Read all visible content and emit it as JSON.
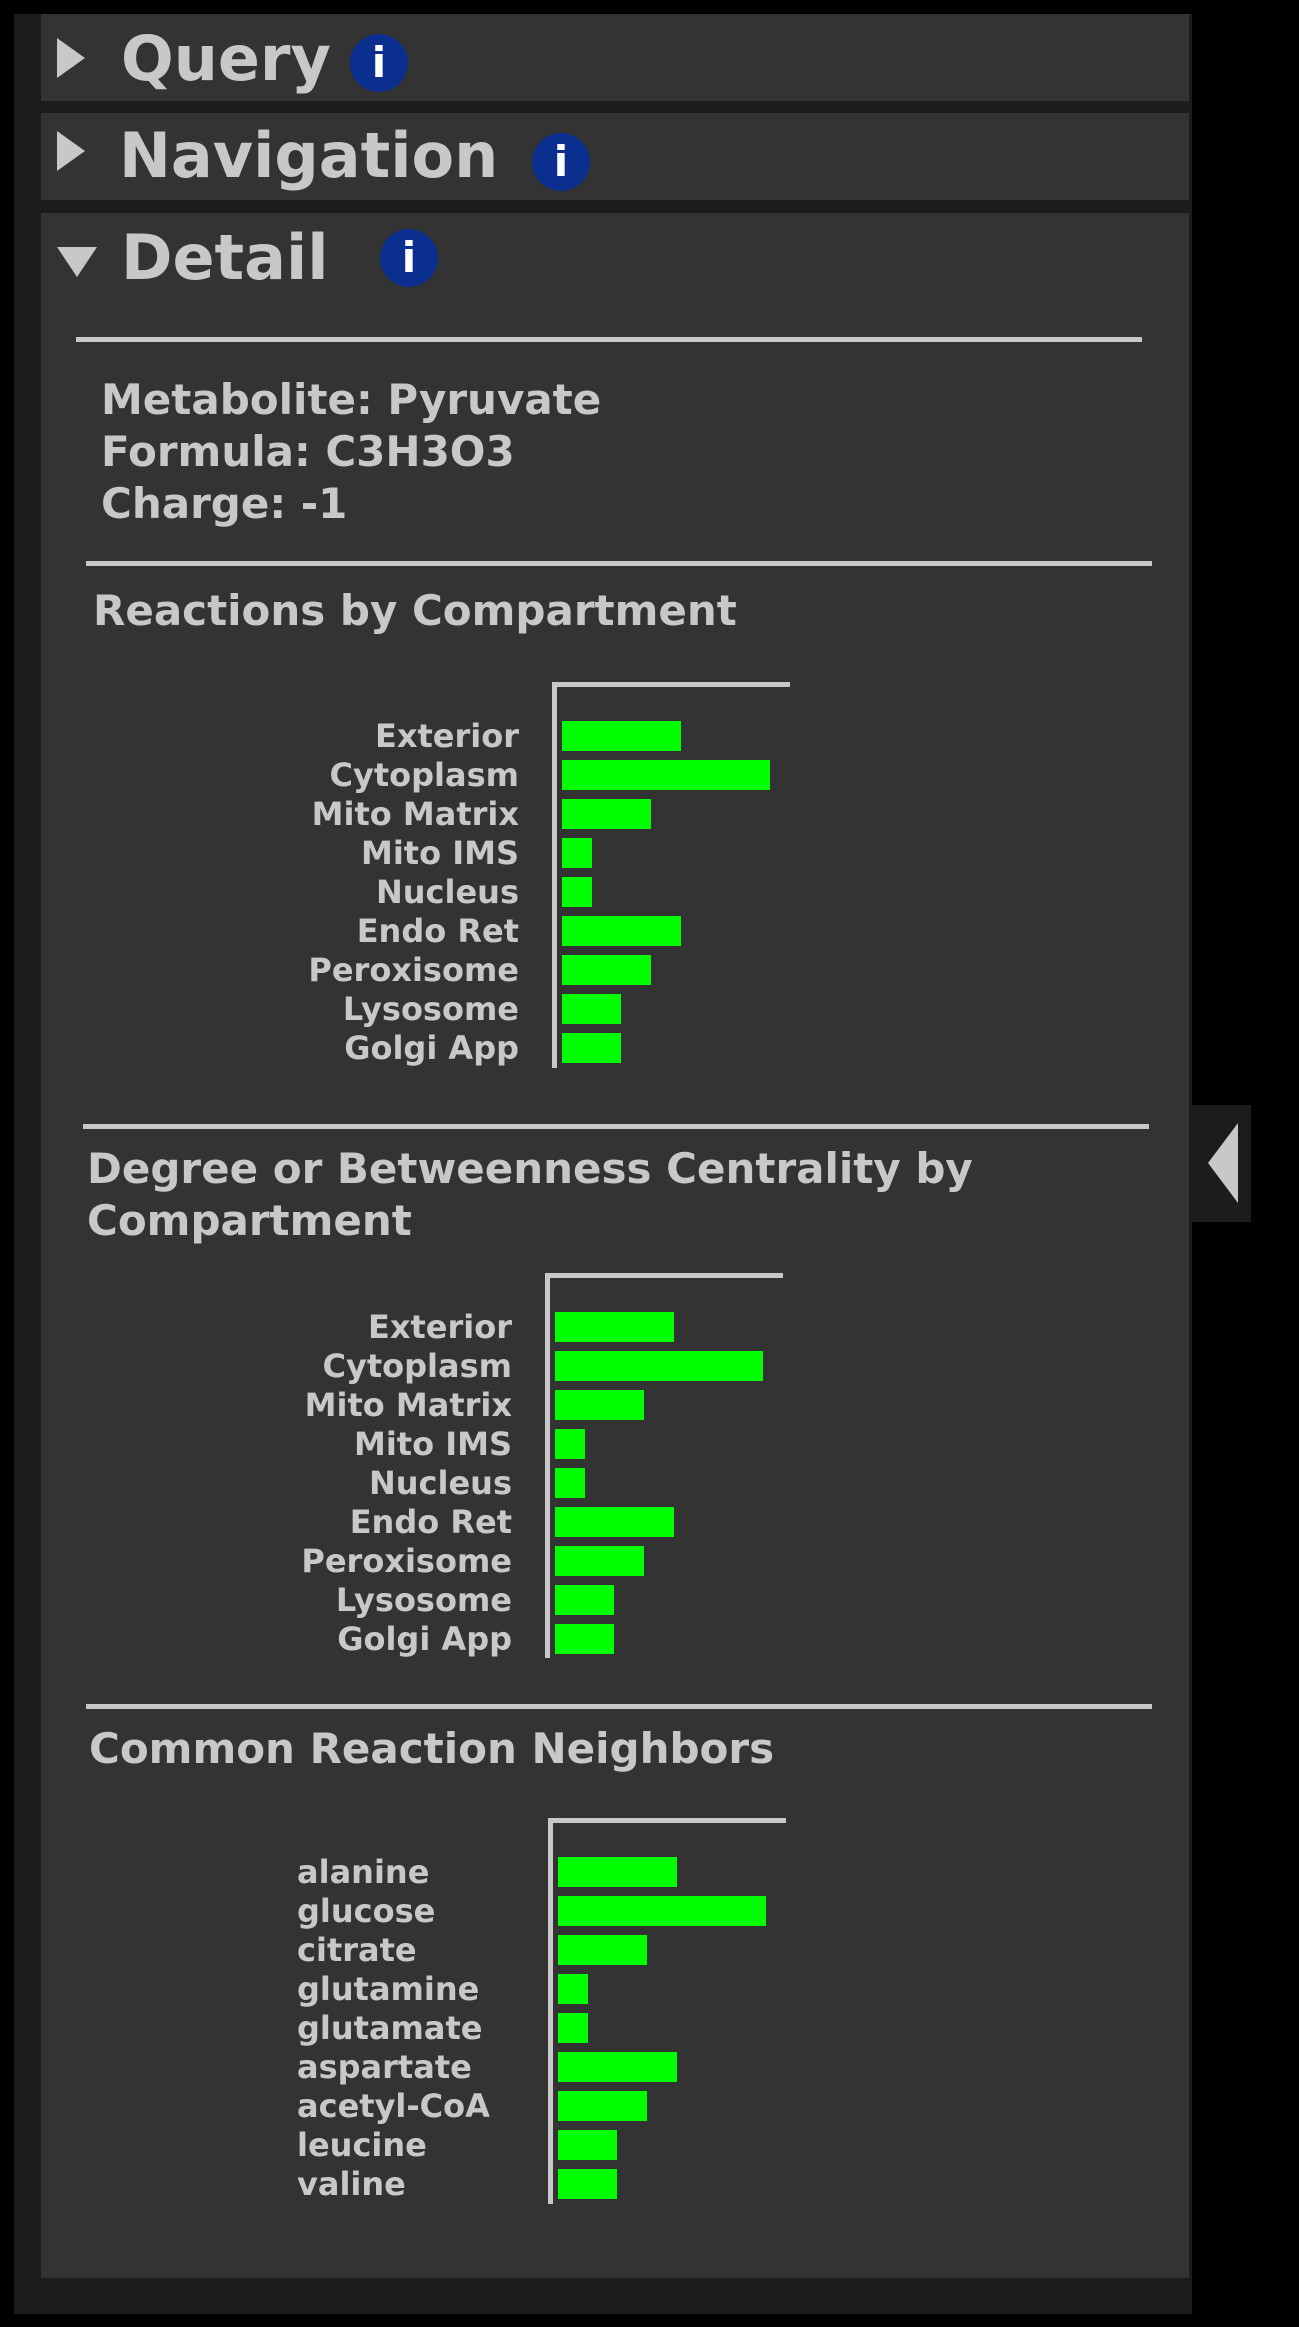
{
  "sections": {
    "query": {
      "title": "Query",
      "info": "i",
      "expanded": false
    },
    "navigation": {
      "title": "Navigation",
      "info": "i",
      "expanded": false
    },
    "detail": {
      "title": "Detail",
      "info": "i",
      "expanded": true
    }
  },
  "metabolite": {
    "name_line": "Metabolite: Pyruvate",
    "formula_line": "Formula: C3H3O3",
    "charge_line": "Charge: -1"
  },
  "colors": {
    "bar": "#00ff00",
    "info_icon": "#0a2f8f",
    "panel_bg": "#333333"
  },
  "icons": {
    "section_collapsed": "triangle-right-icon",
    "section_expanded": "triangle-down-icon",
    "info": "info-icon",
    "collapse_panel": "triangle-left-icon"
  },
  "chart_data": [
    {
      "type": "bar",
      "orientation": "horizontal",
      "title": "Reactions by Compartment",
      "categories": [
        "Exterior",
        "Cytoplasm",
        "Mito Matrix",
        "Mito IMS",
        "Nucleus",
        "Endo Ret",
        "Peroxisome",
        "Lysosome",
        "Golgi App"
      ],
      "values": [
        4,
        7,
        3,
        1,
        1,
        4,
        3,
        2,
        2
      ],
      "xlim": [
        0,
        8
      ],
      "grid": false,
      "legend": "none"
    },
    {
      "type": "bar",
      "orientation": "horizontal",
      "title": "Degree or Betweenness Centrality by Compartment",
      "categories": [
        "Exterior",
        "Cytoplasm",
        "Mito Matrix",
        "Mito IMS",
        "Nucleus",
        "Endo Ret",
        "Peroxisome",
        "Lysosome",
        "Golgi App"
      ],
      "values": [
        4,
        7,
        3,
        1,
        1,
        4,
        3,
        2,
        2
      ],
      "xlim": [
        0,
        8
      ],
      "grid": false,
      "legend": "none"
    },
    {
      "type": "bar",
      "orientation": "horizontal",
      "title": "Common Reaction Neighbors",
      "categories": [
        "alanine",
        "glucose",
        "citrate",
        "glutamine",
        "glutamate",
        "aspartate",
        "acetyl-CoA",
        "leucine",
        "valine"
      ],
      "values": [
        4,
        7,
        3,
        1,
        1,
        4,
        3,
        2,
        2
      ],
      "xlim": [
        0,
        8
      ],
      "grid": false,
      "legend": "none"
    }
  ]
}
